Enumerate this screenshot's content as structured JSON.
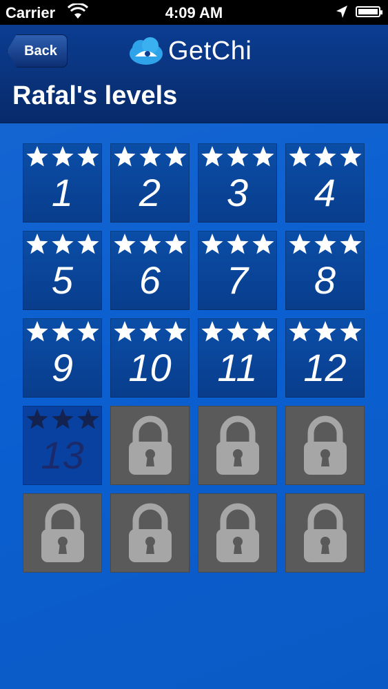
{
  "status_bar": {
    "carrier": "Carrier",
    "time": "4:09 AM"
  },
  "nav": {
    "back_label": "Back",
    "brand_name": "GetChi",
    "title": "Rafal's levels"
  },
  "levels": [
    {
      "label": "1",
      "stars": 3,
      "locked": false
    },
    {
      "label": "2",
      "stars": 3,
      "locked": false
    },
    {
      "label": "3",
      "stars": 3,
      "locked": false
    },
    {
      "label": "4",
      "stars": 3,
      "locked": false
    },
    {
      "label": "5",
      "stars": 3,
      "locked": false
    },
    {
      "label": "6",
      "stars": 3,
      "locked": false
    },
    {
      "label": "7",
      "stars": 3,
      "locked": false
    },
    {
      "label": "8",
      "stars": 3,
      "locked": false
    },
    {
      "label": "9",
      "stars": 3,
      "locked": false
    },
    {
      "label": "10",
      "stars": 3,
      "locked": false
    },
    {
      "label": "11",
      "stars": 3,
      "locked": false
    },
    {
      "label": "12",
      "stars": 3,
      "locked": false
    },
    {
      "label": "13",
      "stars": 0,
      "locked": false,
      "current": true
    },
    {
      "label": "",
      "stars": 0,
      "locked": true
    },
    {
      "label": "",
      "stars": 0,
      "locked": true
    },
    {
      "label": "",
      "stars": 0,
      "locked": true
    },
    {
      "label": "",
      "stars": 0,
      "locked": true
    },
    {
      "label": "",
      "stars": 0,
      "locked": true
    },
    {
      "label": "",
      "stars": 0,
      "locked": true
    },
    {
      "label": "",
      "stars": 0,
      "locked": true
    }
  ],
  "colors": {
    "star_earned": "#ffffff",
    "star_empty": "#14224f",
    "locked_tile": "#5a5a5a",
    "lock_icon": "#a6a6a6"
  },
  "icons": {
    "status": [
      "wifi-icon",
      "location-arrow-icon",
      "battery-icon"
    ],
    "brand": "getchi-cloud-logo-icon",
    "tiles": [
      "star-icon",
      "lock-icon"
    ]
  }
}
